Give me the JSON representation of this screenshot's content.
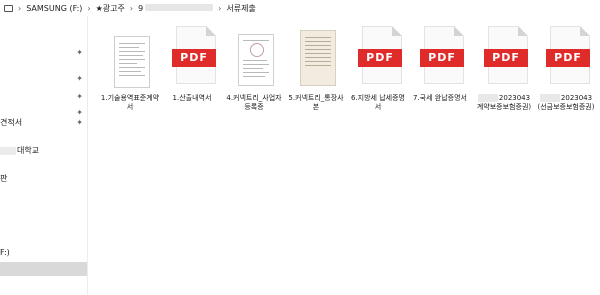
{
  "address_bar": {
    "pc_icon": "pc-icon",
    "drive": "SAMSUNG (F:)",
    "folder1": "★광고주",
    "folder2": "9",
    "folder3": "서류제출",
    "separator": "›"
  },
  "sidebar": {
    "items": [
      {
        "label": "",
        "pinned": true
      },
      {
        "label": "",
        "pinned": true
      },
      {
        "label": "",
        "pinned": true
      },
      {
        "label": "",
        "pinned": true
      },
      {
        "label": "견적서",
        "pinned": true
      },
      {
        "label": "대학교",
        "pinned": false
      },
      {
        "label": "판",
        "pinned": false
      },
      {
        "label": "F:)",
        "pinned": false
      },
      {
        "label": "",
        "pinned": false
      }
    ],
    "pin_icon": "pin-icon"
  },
  "files": [
    {
      "name": "1.기술용역표준계약서",
      "thumb": "doc"
    },
    {
      "name": "1.산출내역서",
      "thumb": "pdf"
    },
    {
      "name": "4.커넥트리_사업자등록증",
      "thumb": "doc-seal"
    },
    {
      "name": "5.커넥트리_통장사본",
      "thumb": "doc-beige"
    },
    {
      "name": "6.지방세 납세증명서",
      "thumb": "pdf"
    },
    {
      "name": "7.국세 완납증명서",
      "thumb": "pdf"
    },
    {
      "name": "2023043 계약보증보험증권)",
      "thumb": "pdf"
    },
    {
      "name": "2023043 (선금보증보험증권)",
      "thumb": "pdf"
    }
  ],
  "pdf_badge_text": "PDF"
}
